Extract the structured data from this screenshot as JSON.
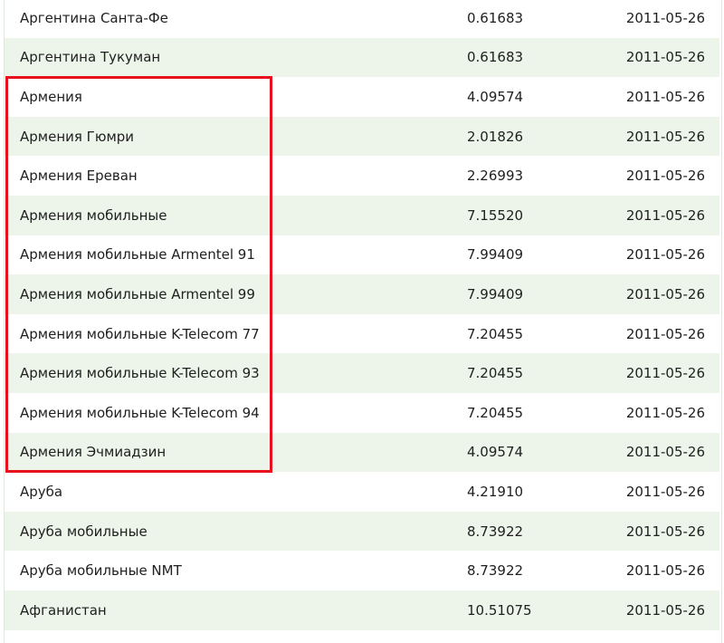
{
  "table": {
    "rows": [
      {
        "name": "Аргентина Санта-Фе",
        "rate": "0.61683",
        "date": "2011-05-26"
      },
      {
        "name": "Аргентина Тукуман",
        "rate": "0.61683",
        "date": "2011-05-26"
      },
      {
        "name": "Армения",
        "rate": "4.09574",
        "date": "2011-05-26"
      },
      {
        "name": "Армения Гюмри",
        "rate": "2.01826",
        "date": "2011-05-26"
      },
      {
        "name": "Армения Ереван",
        "rate": "2.26993",
        "date": "2011-05-26"
      },
      {
        "name": "Армения мобильные",
        "rate": "7.15520",
        "date": "2011-05-26"
      },
      {
        "name": "Армения мобильные Armentel 91",
        "rate": "7.99409",
        "date": "2011-05-26"
      },
      {
        "name": "Армения мобильные Armentel 99",
        "rate": "7.99409",
        "date": "2011-05-26"
      },
      {
        "name": "Армения мобильные K-Telecom 77",
        "rate": "7.20455",
        "date": "2011-05-26"
      },
      {
        "name": "Армения мобильные K-Telecom 93",
        "rate": "7.20455",
        "date": "2011-05-26"
      },
      {
        "name": "Армения мобильные K-Telecom 94",
        "rate": "7.20455",
        "date": "2011-05-26"
      },
      {
        "name": "Армения Эчмиадзин",
        "rate": "4.09574",
        "date": "2011-05-26"
      },
      {
        "name": "Аруба",
        "rate": "4.21910",
        "date": "2011-05-26"
      },
      {
        "name": "Аруба мобильные",
        "rate": "8.73922",
        "date": "2011-05-26"
      },
      {
        "name": "Аруба мобильные NMT",
        "rate": "8.73922",
        "date": "2011-05-26"
      },
      {
        "name": "Афганистан",
        "rate": "10.51075",
        "date": "2011-05-26"
      }
    ]
  },
  "colors": {
    "row_alt": "#edf5ea",
    "row_base": "#ffffff",
    "highlight": "#e8101c"
  }
}
